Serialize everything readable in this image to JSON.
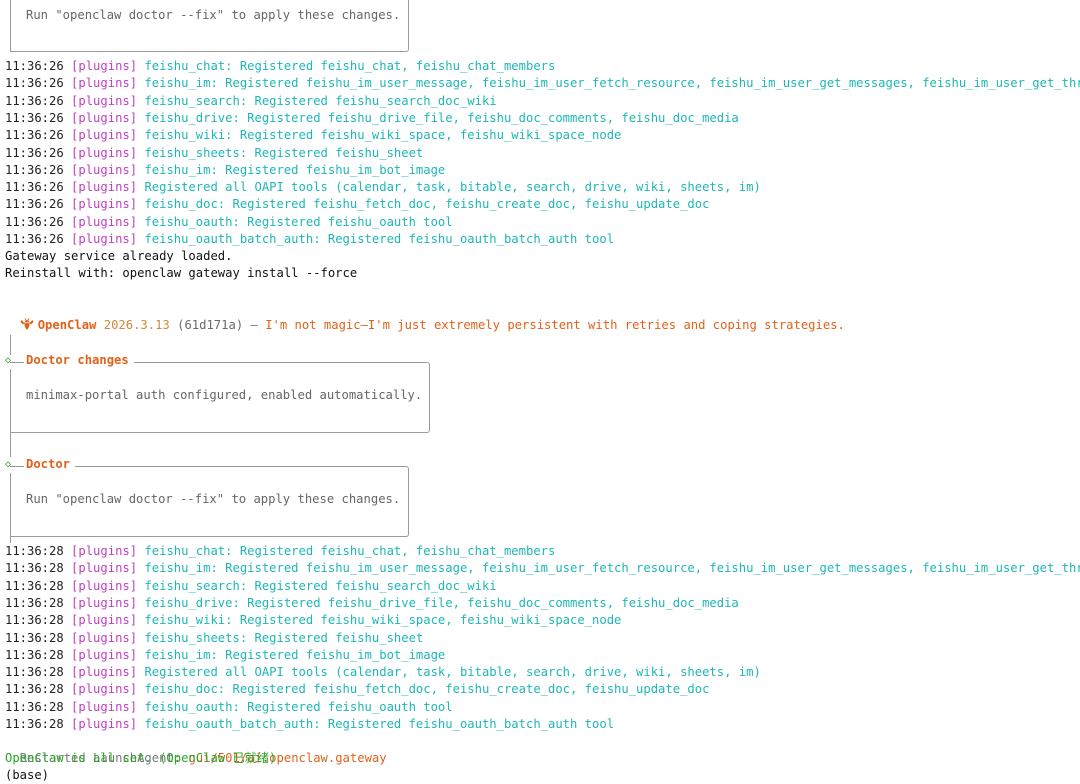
{
  "top_box": {
    "text": "Run \"openclaw doctor --fix\" to apply these changes."
  },
  "log1": [
    {
      "ts": "11:36:26",
      "tag": "[plugins]",
      "msg": "feishu_chat: Registered feishu_chat, feishu_chat_members"
    },
    {
      "ts": "11:36:26",
      "tag": "[plugins]",
      "msg": "feishu_im: Registered feishu_im_user_message, feishu_im_user_fetch_resource, feishu_im_user_get_messages, feishu_im_user_get_thread_"
    },
    {
      "ts": "11:36:26",
      "tag": "[plugins]",
      "msg": "feishu_search: Registered feishu_search_doc_wiki"
    },
    {
      "ts": "11:36:26",
      "tag": "[plugins]",
      "msg": "feishu_drive: Registered feishu_drive_file, feishu_doc_comments, feishu_doc_media"
    },
    {
      "ts": "11:36:26",
      "tag": "[plugins]",
      "msg": "feishu_wiki: Registered feishu_wiki_space, feishu_wiki_space_node"
    },
    {
      "ts": "11:36:26",
      "tag": "[plugins]",
      "msg": "feishu_sheets: Registered feishu_sheet"
    },
    {
      "ts": "11:36:26",
      "tag": "[plugins]",
      "msg": "feishu_im: Registered feishu_im_bot_image"
    },
    {
      "ts": "11:36:26",
      "tag": "[plugins]",
      "msg": "Registered all OAPI tools (calendar, task, bitable, search, drive, wiki, sheets, im)"
    },
    {
      "ts": "11:36:26",
      "tag": "[plugins]",
      "msg": "feishu_doc: Registered feishu_fetch_doc, feishu_create_doc, feishu_update_doc"
    },
    {
      "ts": "11:36:26",
      "tag": "[plugins]",
      "msg": "feishu_oauth: Registered feishu_oauth tool"
    },
    {
      "ts": "11:36:26",
      "tag": "[plugins]",
      "msg": "feishu_oauth_batch_auth: Registered feishu_oauth_batch_auth tool"
    }
  ],
  "gateway_loaded": "Gateway service already loaded.",
  "reinstall_hint": "Reinstall with: openclaw gateway install --force",
  "banner": {
    "name": "OpenClaw",
    "version": "2026.3.13",
    "commit": "(61d171a)",
    "dash": "—",
    "tagline": "I'm not magic—I'm just extremely persistent with retries and coping strategies."
  },
  "doctor_changes": {
    "title": "Doctor changes",
    "text": "minimax-portal auth configured, enabled automatically."
  },
  "doctor": {
    "title": "Doctor",
    "text": "Run \"openclaw doctor --fix\" to apply these changes."
  },
  "log2": [
    {
      "ts": "11:36:28",
      "tag": "[plugins]",
      "msg": "feishu_chat: Registered feishu_chat, feishu_chat_members"
    },
    {
      "ts": "11:36:28",
      "tag": "[plugins]",
      "msg": "feishu_im: Registered feishu_im_user_message, feishu_im_user_fetch_resource, feishu_im_user_get_messages, feishu_im_user_get_thread_"
    },
    {
      "ts": "11:36:28",
      "tag": "[plugins]",
      "msg": "feishu_search: Registered feishu_search_doc_wiki"
    },
    {
      "ts": "11:36:28",
      "tag": "[plugins]",
      "msg": "feishu_drive: Registered feishu_drive_file, feishu_doc_comments, feishu_doc_media"
    },
    {
      "ts": "11:36:28",
      "tag": "[plugins]",
      "msg": "feishu_wiki: Registered feishu_wiki_space, feishu_wiki_space_node"
    },
    {
      "ts": "11:36:28",
      "tag": "[plugins]",
      "msg": "feishu_sheets: Registered feishu_sheet"
    },
    {
      "ts": "11:36:28",
      "tag": "[plugins]",
      "msg": "feishu_im: Registered feishu_im_bot_image"
    },
    {
      "ts": "11:36:28",
      "tag": "[plugins]",
      "msg": "Registered all OAPI tools (calendar, task, bitable, search, drive, wiki, sheets, im)"
    },
    {
      "ts": "11:36:28",
      "tag": "[plugins]",
      "msg": "feishu_doc: Registered feishu_fetch_doc, feishu_create_doc, feishu_update_doc"
    },
    {
      "ts": "11:36:28",
      "tag": "[plugins]",
      "msg": "feishu_oauth: Registered feishu_oauth tool"
    },
    {
      "ts": "11:36:28",
      "tag": "[plugins]",
      "msg": "feishu_oauth_batch_auth: Registered feishu_oauth_batch_auth tool"
    }
  ],
  "restarted": {
    "label": "Restarted LaunchAgent:",
    "target": "gui/501/ai.openclaw.gateway"
  },
  "all_set": "OpenClaw is all set. (OpenClaw 已就绪)",
  "prompt": "(base)",
  "colors": {
    "timestamp": "#222222",
    "plugins_tag": "#c040c0",
    "plugin_message": "#1fb6b6",
    "brand_orange": "#e0621a",
    "success_green": "#2aa52a",
    "box_border": "#9a9a9a"
  },
  "icons": {
    "brand": "lobster-icon",
    "step_marker": "diamond-icon"
  }
}
